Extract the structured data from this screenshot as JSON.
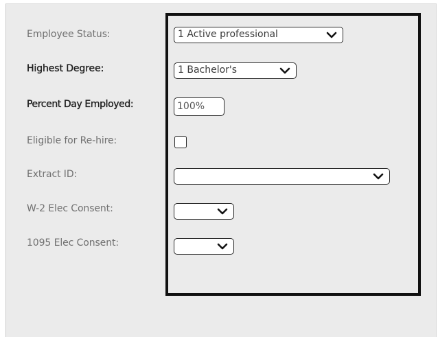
{
  "form": {
    "employee_status": {
      "label": "Employee Status:",
      "value": "1 Active professional"
    },
    "highest_degree": {
      "label": "Highest Degree:",
      "value": "1 Bachelor's"
    },
    "percent_day_employed": {
      "label": "Percent Day Employed:",
      "value": "100%"
    },
    "eligible_rehire": {
      "label": "Eligible for Re-hire:",
      "checked": false
    },
    "extract_id": {
      "label": "Extract ID:",
      "value": ""
    },
    "w2_consent": {
      "label": "W-2 Elec Consent:",
      "value": ""
    },
    "consent_1095": {
      "label": "1095 Elec Consent:",
      "value": ""
    }
  },
  "colors": {
    "panel_background": "#ebebeb",
    "highlight_border": "#111111",
    "control_border": "#2b2b2b",
    "label_muted": "#707070",
    "label_bold": "#1e1e1e"
  },
  "icons": {
    "dropdown": "chevron-down-icon"
  }
}
